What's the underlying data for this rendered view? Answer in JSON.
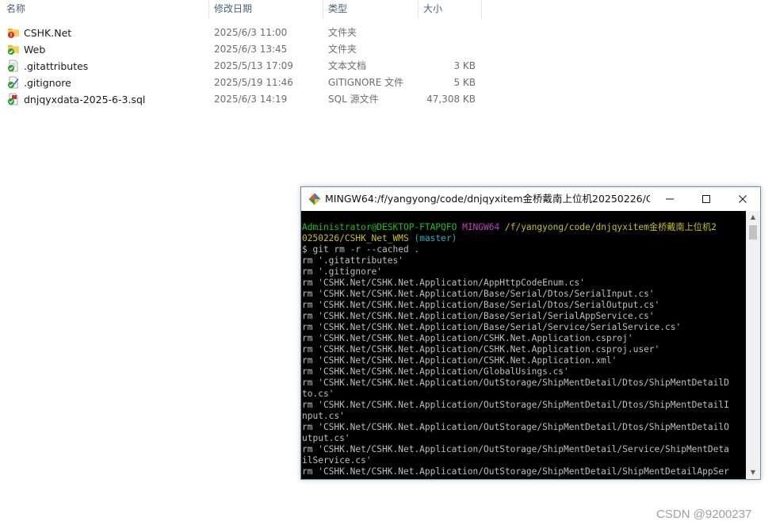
{
  "explorer": {
    "columns": {
      "name": "名称",
      "date": "修改日期",
      "type": "类型",
      "size": "大小"
    },
    "sort_indicator": "^",
    "files": [
      {
        "name": "CSHK.Net",
        "date": "2025/6/3 11:00",
        "type": "文件夹",
        "size": "",
        "icon": "folder-conflict-icon"
      },
      {
        "name": "Web",
        "date": "2025/6/3 13:45",
        "type": "文件夹",
        "size": "",
        "icon": "folder-synced-icon"
      },
      {
        "name": ".gitattributes",
        "date": "2025/5/13 17:09",
        "type": "文本文档",
        "size": "3 KB",
        "icon": "text-file-synced-icon"
      },
      {
        "name": ".gitignore",
        "date": "2025/5/19 11:46",
        "type": "GITIGNORE 文件",
        "size": "5 KB",
        "icon": "file-edit-synced-icon"
      },
      {
        "name": "dnjqyxdata-2025-6-3.sql",
        "date": "2025/6/3 14:19",
        "type": "SQL 源文件",
        "size": "47,308 KB",
        "icon": "sql-file-synced-icon"
      }
    ]
  },
  "terminal": {
    "title": "MINGW64:/f/yangyong/code/dnjqyxitem金桥戴南上位机20250226/CS...",
    "prompt": {
      "user": "Administrator@DESKTOP-FTAPQFO",
      "env": "MINGW64",
      "path_line1": "/f/yangyong/code/dnjqyxitem金桥戴南上位机2",
      "path_line2": "0250226/CSHK_Net_WMS",
      "branch": "(master)"
    },
    "command": "$ git rm -r --cached .",
    "lines": [
      "rm '.gitattributes'",
      "rm '.gitignore'",
      "rm 'CSHK.Net/CSHK.Net.Application/AppHttpCodeEnum.cs'",
      "rm 'CSHK.Net/CSHK.Net.Application/Base/Serial/Dtos/SerialInput.cs'",
      "rm 'CSHK.Net/CSHK.Net.Application/Base/Serial/Dtos/SerialOutput.cs'",
      "rm 'CSHK.Net/CSHK.Net.Application/Base/Serial/SerialAppService.cs'",
      "rm 'CSHK.Net/CSHK.Net.Application/Base/Serial/Service/SerialService.cs'",
      "rm 'CSHK.Net/CSHK.Net.Application/CSHK.Net.Application.csproj'",
      "rm 'CSHK.Net/CSHK.Net.Application/CSHK.Net.Application.csproj.user'",
      "rm 'CSHK.Net/CSHK.Net.Application/CSHK.Net.Application.xml'",
      "rm 'CSHK.Net/CSHK.Net.Application/GlobalUsings.cs'",
      "rm 'CSHK.Net/CSHK.Net.Application/OutStorage/ShipMentDetail/Dtos/ShipMentDetailD",
      "to.cs'",
      "rm 'CSHK.Net/CSHK.Net.Application/OutStorage/ShipMentDetail/Dtos/ShipMentDetailI",
      "nput.cs'",
      "rm 'CSHK.Net/CSHK.Net.Application/OutStorage/ShipMentDetail/Dtos/ShipMentDetailO",
      "utput.cs'",
      "rm 'CSHK.Net/CSHK.Net.Application/OutStorage/ShipMentDetail/Service/ShipMentDeta",
      "ilService.cs'",
      "rm 'CSHK.Net/CSHK.Net.Application/OutStorage/ShipMentDetail/ShipMentDetailAppSer"
    ]
  },
  "watermark": "CSDN @9200237",
  "colors": {
    "prompt_user": "#20c020",
    "prompt_env": "#c040c0",
    "prompt_path": "#c8c020",
    "prompt_branch": "#20b0c0",
    "terminal_bg": "#000000",
    "terminal_text": "#bfbfbf"
  }
}
